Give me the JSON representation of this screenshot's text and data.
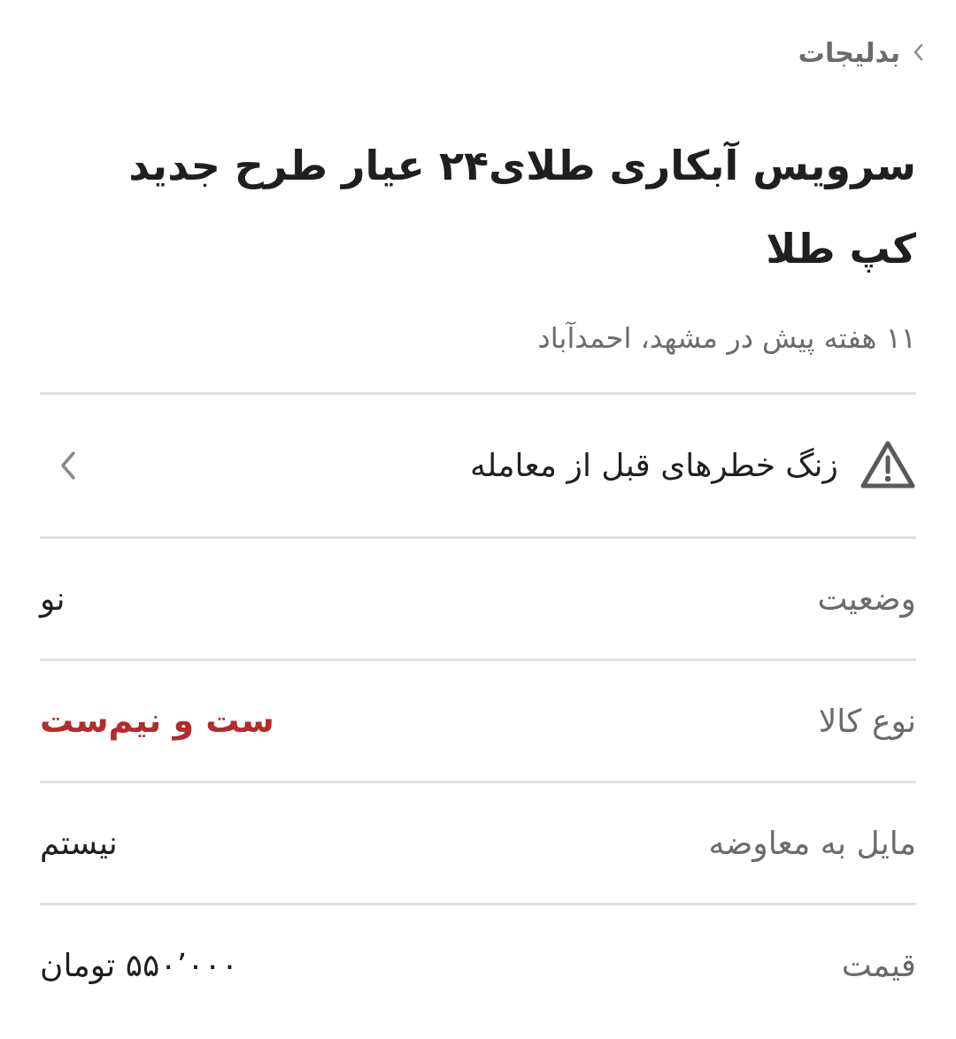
{
  "breadcrumb": {
    "label": "بدلیجات"
  },
  "title": "سرویس آبکاری طلای۲۴ عیار طرح جدید کپ طلا",
  "subtitle": "۱۱ هفته پیش در مشهد، احمدآباد",
  "warning": {
    "label": "زنگ خطرهای قبل از معامله"
  },
  "rows": [
    {
      "label": "وضعیت",
      "value": "نو",
      "highlight": false
    },
    {
      "label": "نوع کالا",
      "value": "ست و نیم‌ست",
      "highlight": true
    },
    {
      "label": "مایل به معاوضه",
      "value": "نیستم",
      "highlight": false
    },
    {
      "label": "قیمت",
      "value": "۵۵۰٬۰۰۰ تومان",
      "highlight": false
    }
  ]
}
